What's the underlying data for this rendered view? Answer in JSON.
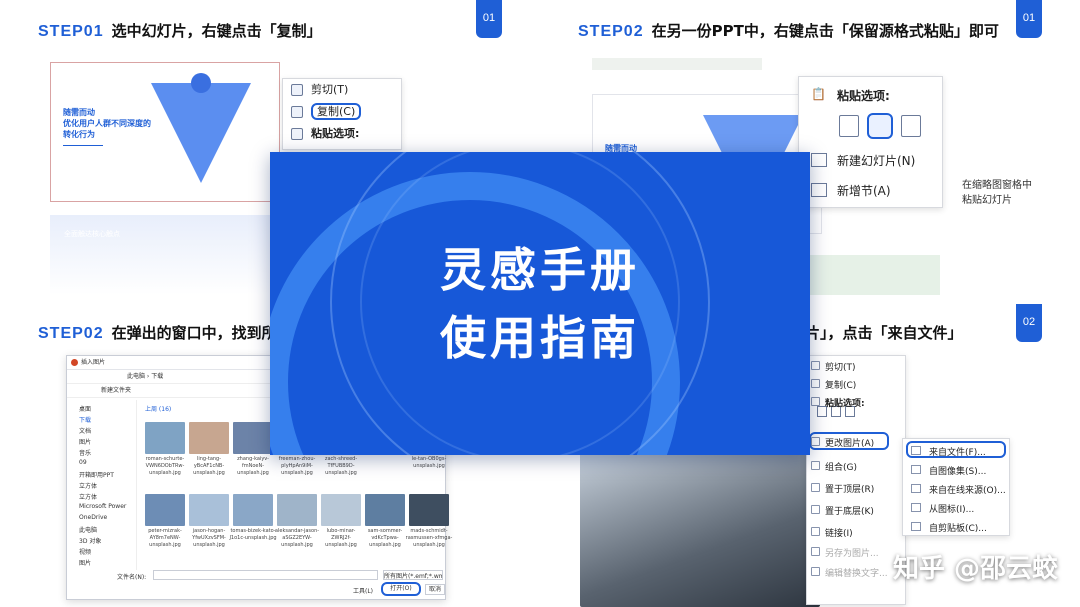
{
  "top_left": {
    "step_num": "STEP01",
    "step_text": "选中幻灯片，右键点击「复制」",
    "tag": "01",
    "slide_text": "随需而动\n优化用户人群不同深度的转化行为",
    "slide_footer": "全面触达核心触点",
    "menu": [
      "剪切(T)",
      "复制(C)",
      "粘贴选项:"
    ]
  },
  "top_right": {
    "step_num": "STEP02",
    "step_text": "在另一份PPT中，右键点击「保留源格式粘贴」即可",
    "tag": "01",
    "slide_text": "随需而动",
    "menu_header": "粘贴选项:",
    "menu": [
      "新建幻灯片(N)",
      "新增节(A)"
    ],
    "side_note": "在缩略图窗格中\n粘贴幻灯片"
  },
  "bottom_left": {
    "step_num": "STEP02",
    "step_text": "在弹出的窗口中，找到所",
    "dialog": {
      "title": "插入图片",
      "path": "此电脑 › 下载",
      "new_folder": "新建文件夹",
      "section": "上周 (16)",
      "sidebar": [
        "桌面",
        "下载",
        "文档",
        "图片",
        "音乐",
        "09",
        "开箱即用PPT",
        "立方体",
        "立方体",
        "Microsoft Power",
        "OneDrive",
        "此电脑",
        "3D 对象",
        "视频",
        "图片"
      ],
      "files": [
        "roman-schurte-VWN6DObTRw-unsplash.jpg",
        "ling-tang-yBcAF1cNB-unsplash.jpg",
        "zhang-kaiyv-fmNoeN-unsplash.jpg",
        "freeman-zhou-plyHpAn9iM-unsplash.jpg",
        "zach-shreed-TfFUBB9D-unsplash.jpg",
        "",
        "le-tan-OB0gs-unsplash.jpg",
        "peter-mizrak-AY8m7eNW-unsplash.jpg",
        "jason-hogan-YfwUXzvSFM-unsplash.jpg",
        "tomas-bizek-kato-J1o1c-unsplash.jpg",
        "aleksandar-jason-aSGZ2EYW-unsplash.jpg",
        "lubo-minar-ZWRJ2f-unsplash.jpg",
        "sam-sommer-vdKcTpwa-unsplash.jpg",
        "mads-schmidt-rasmussen-xfmga-unsplash.jpg"
      ],
      "filename_label": "文件名(N):",
      "filter": "所有图片(*.emf;*.wmf;*.jpg;*.j",
      "tools": "工具(L)",
      "open": "打开(O)",
      "cancel": "取消"
    }
  },
  "bottom_right": {
    "step_text": "片」，点击「来自文件」",
    "tag": "02",
    "menu": [
      "剪切(T)",
      "复制(C)",
      "粘贴选项:",
      "更改图片(A)",
      "组合(G)",
      "置于顶层(R)",
      "置于底层(K)",
      "链接(I)",
      "另存为图片...",
      "编辑替换文字..."
    ],
    "submenu": [
      "来自文件(F)...",
      "自图像集(S)...",
      "来自在线来源(O)...",
      "从图标(I)...",
      "自剪贴板(C)..."
    ]
  },
  "cover": {
    "line1": "灵感手册",
    "line2": "使用指南"
  },
  "watermark": "知乎 @邵云蛟",
  "colors": {
    "accent": "#1f5fd6",
    "cover_bg": "#1758d8"
  }
}
